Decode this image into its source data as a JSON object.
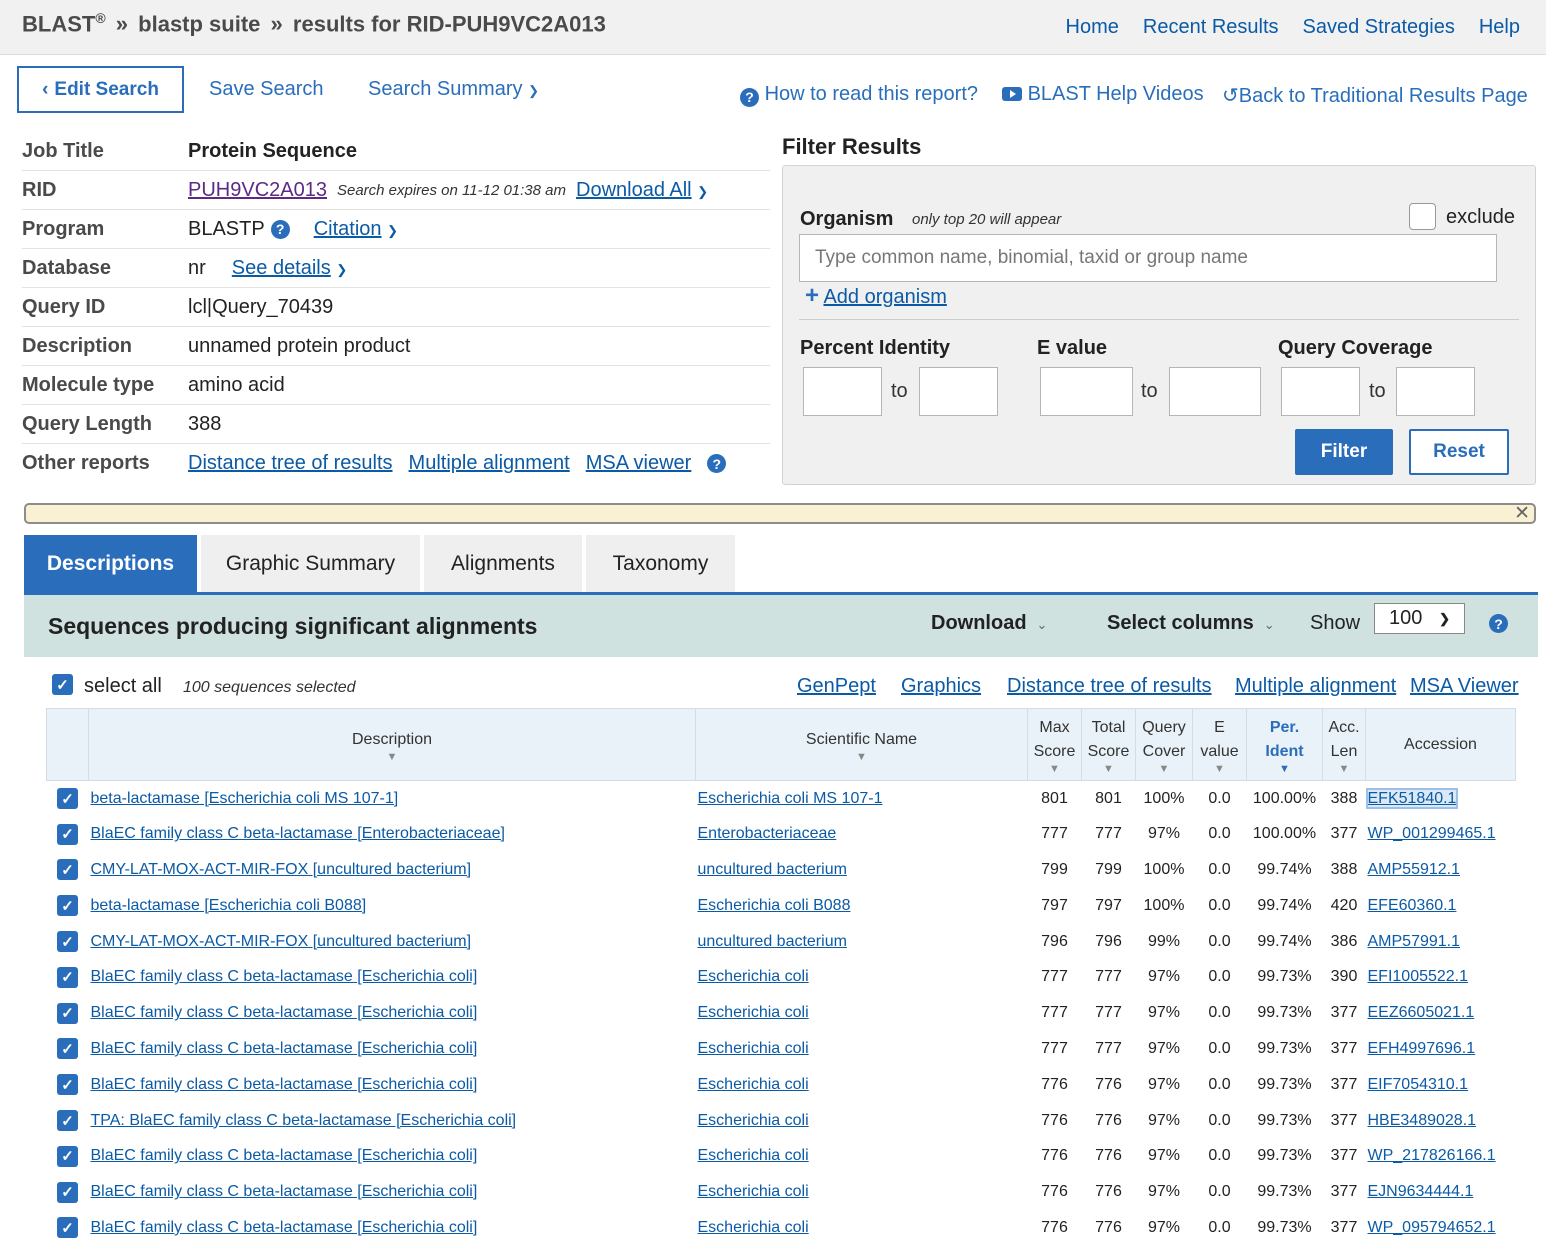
{
  "header": {
    "blast": "BLAST",
    "reg": "®",
    "suite": "blastp suite",
    "results": "results for RID-PUH9VC2A013",
    "nav": [
      "Home",
      "Recent Results",
      "Saved Strategies",
      "Help"
    ]
  },
  "actions": {
    "edit_search": "Edit Search",
    "save_search": "Save Search",
    "search_summary": "Search Summary",
    "how_to_read": "How to read this report?",
    "help_videos": "BLAST Help Videos",
    "back_traditional": "Back to Traditional Results Page"
  },
  "job": {
    "title_label": "Job Title",
    "title": "Protein Sequence",
    "rid_label": "RID",
    "rid": "PUH9VC2A013",
    "expires": "Search expires on 11-12 01:38 am",
    "download_all": "Download All",
    "program_label": "Program",
    "program": "BLASTP",
    "citation": "Citation",
    "database_label": "Database",
    "database": "nr",
    "see_details": "See details",
    "query_id_label": "Query ID",
    "query_id": "lcl|Query_70439",
    "description_label": "Description",
    "description": "unnamed protein product",
    "molecule_label": "Molecule type",
    "molecule": "amino acid",
    "query_length_label": "Query Length",
    "query_length": "388",
    "other_reports_label": "Other reports",
    "distance_tree": "Distance tree of results",
    "multiple_alignment": "Multiple alignment",
    "msa_viewer": "MSA viewer"
  },
  "filter": {
    "title": "Filter Results",
    "organism_label": "Organism",
    "organism_note": "only top 20 will appear",
    "exclude": "exclude",
    "organism_placeholder": "Type common  name, binomial, taxid or group  name",
    "add_organism": "Add organism",
    "percent_identity": "Percent Identity",
    "e_value": "E value",
    "query_coverage": "Query Coverage",
    "to": "to",
    "filter_btn": "Filter",
    "reset_btn": "Reset"
  },
  "tabs": [
    "Descriptions",
    "Graphic Summary",
    "Alignments",
    "Taxonomy"
  ],
  "results_header": {
    "title": "Sequences producing significant alignments",
    "download": "Download",
    "select_columns": "Select columns",
    "show": "Show",
    "show_value": "100"
  },
  "selection": {
    "select_all": "select all",
    "count": "100 sequences selected",
    "links": [
      "GenPept",
      "Graphics",
      "Distance tree of results",
      "Multiple alignment",
      "MSA Viewer"
    ]
  },
  "table": {
    "columns": {
      "description": "Description",
      "scientific_name": "Scientific Name",
      "max_score": [
        "Max",
        "Score"
      ],
      "total_score": [
        "Total",
        "Score"
      ],
      "query_cover": [
        "Query",
        "Cover"
      ],
      "e_value": [
        "E",
        "value"
      ],
      "per_ident": [
        "Per.",
        "Ident"
      ],
      "acc_len": [
        "Acc.",
        "Len"
      ],
      "accession": "Accession"
    },
    "rows": [
      {
        "description": "beta-lactamase [Escherichia coli MS 107-1]",
        "scientific_name": "Escherichia coli MS 107-1",
        "max_score": "801",
        "total_score": "801",
        "query_cover": "100%",
        "e_value": "0.0",
        "per_ident": "100.00%",
        "acc_len": "388",
        "accession": "EFK51840.1"
      },
      {
        "description": "BlaEC family class C beta-lactamase [Enterobacteriaceae]",
        "scientific_name": "Enterobacteriaceae",
        "max_score": "777",
        "total_score": "777",
        "query_cover": "97%",
        "e_value": "0.0",
        "per_ident": "100.00%",
        "acc_len": "377",
        "accession": "WP_001299465.1"
      },
      {
        "description": "CMY-LAT-MOX-ACT-MIR-FOX [uncultured bacterium]",
        "scientific_name": "uncultured bacterium",
        "max_score": "799",
        "total_score": "799",
        "query_cover": "100%",
        "e_value": "0.0",
        "per_ident": "99.74%",
        "acc_len": "388",
        "accession": "AMP55912.1"
      },
      {
        "description": "beta-lactamase [Escherichia coli B088]",
        "scientific_name": "Escherichia coli B088",
        "max_score": "797",
        "total_score": "797",
        "query_cover": "100%",
        "e_value": "0.0",
        "per_ident": "99.74%",
        "acc_len": "420",
        "accession": "EFE60360.1"
      },
      {
        "description": "CMY-LAT-MOX-ACT-MIR-FOX [uncultured bacterium]",
        "scientific_name": "uncultured bacterium",
        "max_score": "796",
        "total_score": "796",
        "query_cover": "99%",
        "e_value": "0.0",
        "per_ident": "99.74%",
        "acc_len": "386",
        "accession": "AMP57991.1"
      },
      {
        "description": "BlaEC family class C beta-lactamase [Escherichia coli]",
        "scientific_name": "Escherichia coli",
        "max_score": "777",
        "total_score": "777",
        "query_cover": "97%",
        "e_value": "0.0",
        "per_ident": "99.73%",
        "acc_len": "390",
        "accession": "EFI1005522.1"
      },
      {
        "description": "BlaEC family class C beta-lactamase [Escherichia coli]",
        "scientific_name": "Escherichia coli",
        "max_score": "777",
        "total_score": "777",
        "query_cover": "97%",
        "e_value": "0.0",
        "per_ident": "99.73%",
        "acc_len": "377",
        "accession": "EEZ6605021.1"
      },
      {
        "description": "BlaEC family class C beta-lactamase [Escherichia coli]",
        "scientific_name": "Escherichia coli",
        "max_score": "777",
        "total_score": "777",
        "query_cover": "97%",
        "e_value": "0.0",
        "per_ident": "99.73%",
        "acc_len": "377",
        "accession": "EFH4997696.1"
      },
      {
        "description": "BlaEC family class C beta-lactamase [Escherichia coli]",
        "scientific_name": "Escherichia coli",
        "max_score": "776",
        "total_score": "776",
        "query_cover": "97%",
        "e_value": "0.0",
        "per_ident": "99.73%",
        "acc_len": "377",
        "accession": "EIF7054310.1"
      },
      {
        "description": "TPA: BlaEC family class C beta-lactamase [Escherichia coli]",
        "scientific_name": "Escherichia coli",
        "max_score": "776",
        "total_score": "776",
        "query_cover": "97%",
        "e_value": "0.0",
        "per_ident": "99.73%",
        "acc_len": "377",
        "accession": "HBE3489028.1"
      },
      {
        "description": "BlaEC family class C beta-lactamase [Escherichia coli]",
        "scientific_name": "Escherichia coli",
        "max_score": "776",
        "total_score": "776",
        "query_cover": "97%",
        "e_value": "0.0",
        "per_ident": "99.73%",
        "acc_len": "377",
        "accession": "WP_217826166.1"
      },
      {
        "description": "BlaEC family class C beta-lactamase [Escherichia coli]",
        "scientific_name": "Escherichia coli",
        "max_score": "776",
        "total_score": "776",
        "query_cover": "97%",
        "e_value": "0.0",
        "per_ident": "99.73%",
        "acc_len": "377",
        "accession": "EJN9634444.1"
      },
      {
        "description": "BlaEC family class C beta-lactamase [Escherichia coli]",
        "scientific_name": "Escherichia coli",
        "max_score": "776",
        "total_score": "776",
        "query_cover": "97%",
        "e_value": "0.0",
        "per_ident": "99.73%",
        "acc_len": "377",
        "accession": "WP_095794652.1"
      }
    ]
  },
  "colors": {
    "accent": "#2a6ebb",
    "link": "#0b5aa6",
    "rid": "#5b2a86",
    "panel": "#cfe2e0",
    "warning": "#faf1d4"
  },
  "icons": [
    "chevron-left-icon",
    "chevron-down-icon",
    "question-circle-icon",
    "video-icon",
    "undo-icon",
    "plus-icon",
    "checkbox-checked-icon",
    "sort-arrow-icon",
    "close-icon"
  ]
}
